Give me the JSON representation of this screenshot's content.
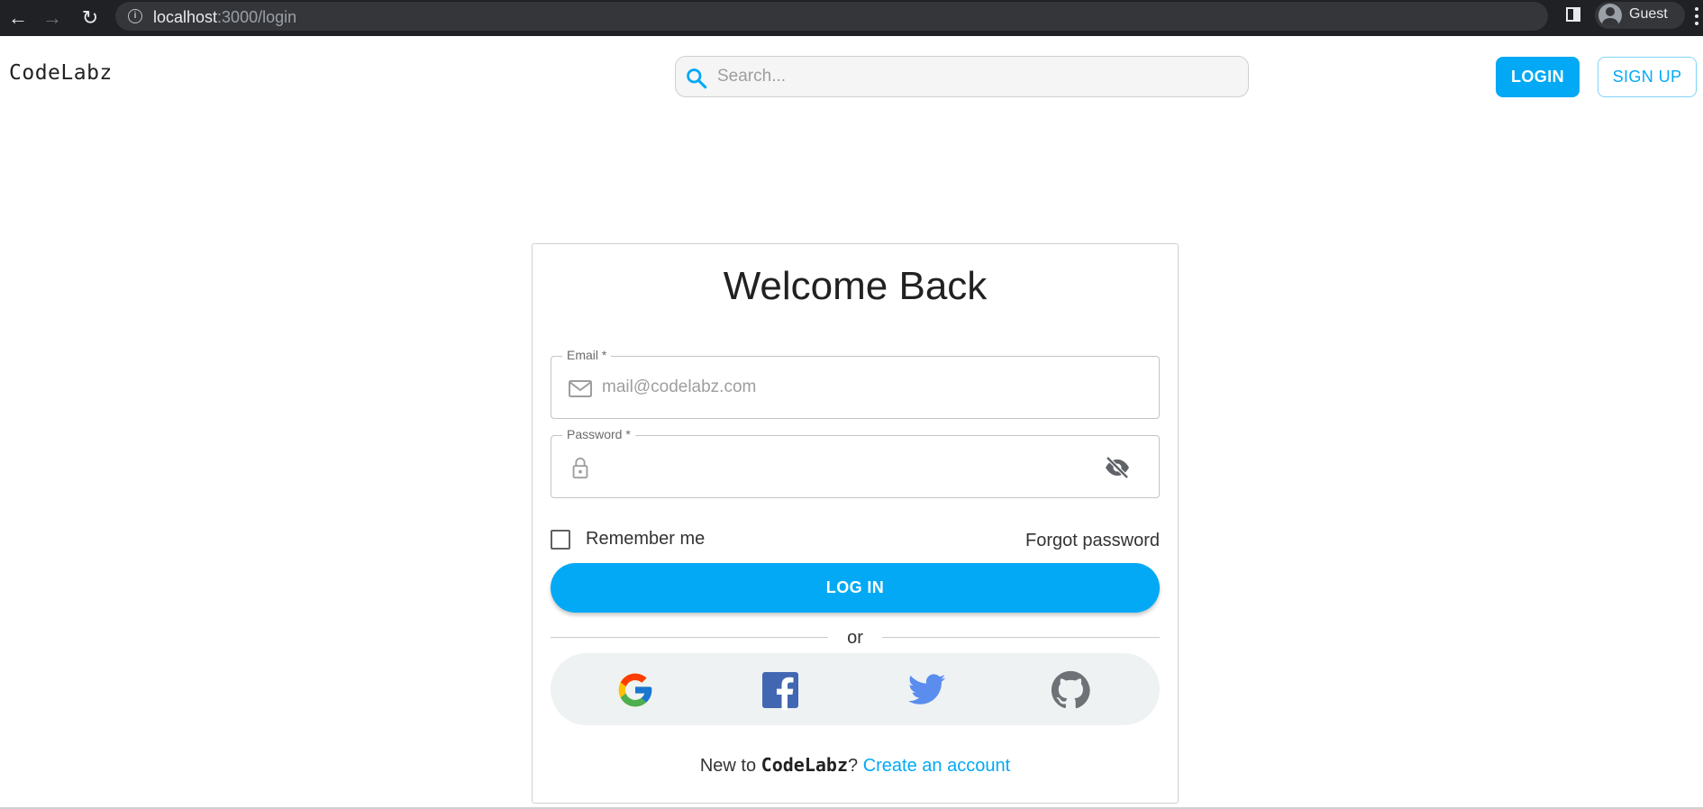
{
  "browser": {
    "url_host": "localhost",
    "url_rest": ":3000/login",
    "profile_name": "Guest"
  },
  "header": {
    "brand": "CodeLabz",
    "search_placeholder": "Search...",
    "login_label": "LOGIN",
    "signup_label": "SIGN UP"
  },
  "login": {
    "title": "Welcome Back",
    "email_label": "Email *",
    "email_placeholder": "mail@codelabz.com",
    "password_label": "Password *",
    "remember_label": "Remember me",
    "forgot_label": "Forgot password",
    "submit_label": "LOG IN",
    "divider_text": "or",
    "social": [
      "google-icon",
      "facebook-icon",
      "twitter-icon",
      "github-icon"
    ],
    "footer_prefix": "New to ",
    "footer_brand": "CodeLabz",
    "footer_qmark": "?",
    "footer_link": "Create an account"
  },
  "colors": {
    "accent": "#03a9f4",
    "chrome_bg": "#202124",
    "social_bg": "#eef2f3"
  }
}
